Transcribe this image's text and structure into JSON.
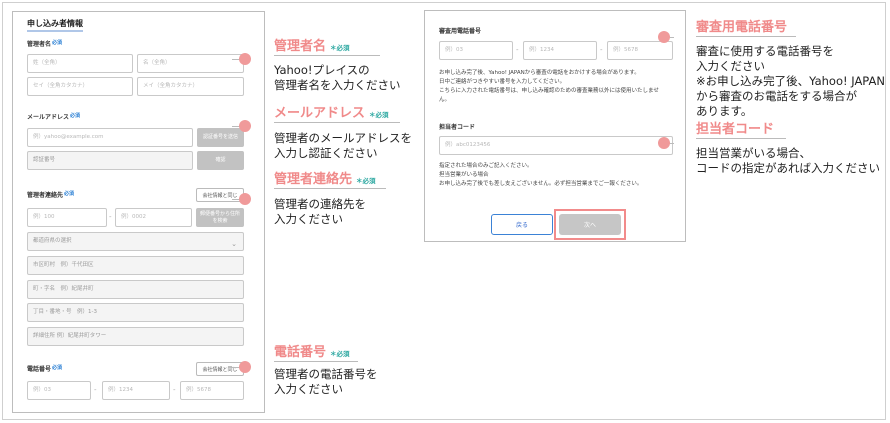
{
  "left_form": {
    "title": "申し込み者情報",
    "required_mark": "必須",
    "manager_name": {
      "label": "管理者名",
      "sei_placeholder": "姓（全角）",
      "mei_placeholder": "名（全角）",
      "sei_kana_placeholder": "セイ（全角カタカナ）",
      "mei_kana_placeholder": "メイ（全角カタカナ）"
    },
    "email": {
      "label": "メールアドレス",
      "placeholder": "例）yahoo@example.com",
      "send_button": "認証番号を送信",
      "code_placeholder": "認証番号",
      "verify_button": "確認"
    },
    "contact": {
      "label": "管理者連絡先",
      "same_as_applicant_button": "会社情報と同じ",
      "postal1_placeholder": "例）100",
      "postal2_placeholder": "例）0002",
      "address_search_button": "郵便番号から住所を検索",
      "prefecture_placeholder": "都道府県の選択",
      "city_placeholder": "市区町村　例）千代田区",
      "town_placeholder": "町・字名　例）紀尾井町",
      "block_placeholder": "丁目・番地・号　例）1-3",
      "building_placeholder": "詳細住所 例）紀尾井町タワー"
    },
    "phone": {
      "label": "電話番号",
      "same_button": "会社情報と同じ",
      "p1_placeholder": "例）03",
      "p2_placeholder": "例）1234",
      "p3_placeholder": "例）5678"
    }
  },
  "right_form": {
    "review_phone_label": "審査用電話番号",
    "p1_placeholder": "例）03",
    "p2_placeholder": "例）1234",
    "p3_placeholder": "例）5678",
    "note_lines": [
      "お申し込み完了後、Yahoo! JAPANから審査の電話をおかけする場合があります。",
      "日中ご連絡がつきやすい番号を入力してください。",
      "こちらに入力された電話番号は、申し込み確認のための審査業務以外には使用いたしませ",
      "ん。"
    ],
    "staff_code_label": "担当者コード",
    "staff_code_placeholder": "例）abc0123456",
    "staff_note_lines": [
      "指定された場合のみご記入ください。",
      "担当営業がいる場合",
      "お申し込み完了後でも差し支えございません。必ず担当営業までご一報ください。"
    ],
    "back_button": "戻る",
    "next_button": "次へ"
  },
  "annotations": {
    "required_mark": "＊必須",
    "manager_name": {
      "title": "管理者名",
      "lines": [
        "Yahoo!プレイスの",
        "管理者名を入力ください"
      ]
    },
    "email": {
      "title": "メールアドレス",
      "lines": [
        "管理者のメールアドレスを",
        "入力し認証ください"
      ]
    },
    "contact": {
      "title": "管理者連絡先",
      "lines": [
        "管理者の連絡先を",
        "入力ください"
      ]
    },
    "phone": {
      "title": "電話番号",
      "lines": [
        "管理者の電話番号を",
        "入力ください"
      ]
    },
    "review_phone": {
      "title": "審査用電話番号",
      "lines": [
        "審査に使用する電話番号を",
        "入力ください",
        "※お申し込み完了後、Yahoo! JAPAN",
        "から審査のお電話をする場合が",
        "あります。"
      ]
    },
    "staff_code": {
      "title": "担当者コード",
      "lines": [
        "担当営業がいる場合、",
        "コードの指定があれば入力ください"
      ]
    }
  }
}
